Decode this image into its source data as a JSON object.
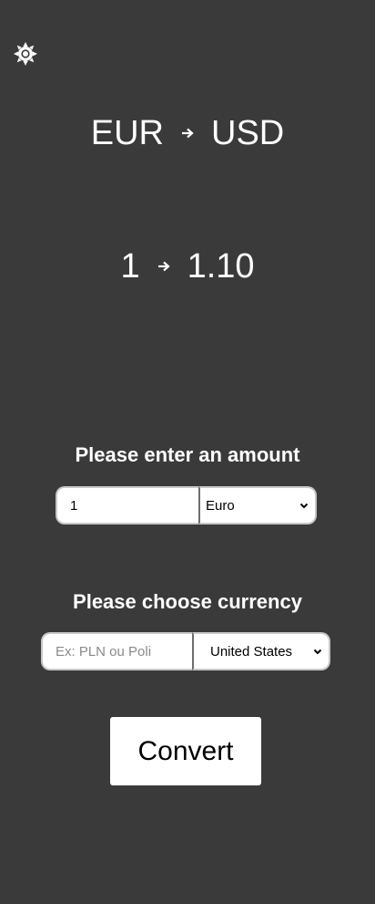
{
  "theme_toggle": {
    "icon": "sun-icon"
  },
  "conversion_header": {
    "from_currency": "EUR",
    "to_currency": "USD",
    "arrow_icon": "arrow-right-icon"
  },
  "rate_display": {
    "from_amount": "1",
    "to_amount": "1.10",
    "arrow_icon": "arrow-right-icon"
  },
  "amount_section": {
    "label": "Please enter an amount",
    "amount_value": "1",
    "currency_selected": "Euro"
  },
  "currency_section": {
    "label": "Please choose currency",
    "search_placeholder": "Ex: PLN ou Poli",
    "search_value": "",
    "country_selected": "United States"
  },
  "convert_button": {
    "label": "Convert"
  },
  "colors": {
    "background": "#3a3a3a",
    "text": "#ffffff",
    "button_bg": "#ffffff"
  }
}
